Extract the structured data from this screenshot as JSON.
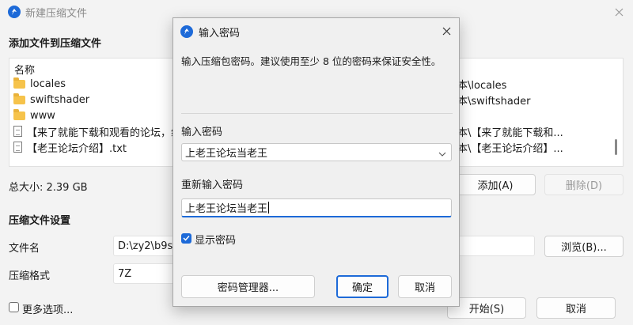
{
  "main_window": {
    "title": "新建压缩文件",
    "add_section_title": "添加文件到压缩文件",
    "column_name": "名称",
    "files": [
      {
        "name": "locales",
        "type": "folder"
      },
      {
        "name": "swiftshader",
        "type": "folder"
      },
      {
        "name": "www",
        "type": "folder"
      },
      {
        "name": "【来了就能下载和观看的论坛，纯",
        "type": "file"
      },
      {
        "name": "【老王论坛介绍】.txt",
        "type": "file"
      }
    ],
    "paths": [
      "本\\locales",
      "本\\swiftshader",
      "",
      "本\\【来了就能下载和...",
      "本\\【老王论坛介绍】..."
    ],
    "total_size": "总大小: 2.39 GB",
    "add_button": "添加(A)",
    "delete_button": "删除(D)",
    "settings_title": "压缩文件设置",
    "filename_label": "文件名",
    "filename_value": "D:\\zy2\\b9sh",
    "browse_button": "浏览(B)...",
    "format_label": "压缩格式",
    "format_value": "7Z",
    "more_options": "更多选项...",
    "start_button": "开始(S)",
    "cancel_button": "取消"
  },
  "dialog": {
    "title": "输入密码",
    "description": "输入压缩包密码。建议使用至少 8 位的密码来保证安全性。",
    "password_label": "输入密码",
    "password_value": "上老王论坛当老王",
    "confirm_label": "重新输入密码",
    "confirm_value": "上老王论坛当老王",
    "show_password_label": "显示密码",
    "show_password_checked": true,
    "manager_button": "密码管理器...",
    "ok_button": "确定",
    "cancel_button": "取消"
  },
  "colors": {
    "accent": "#1d6ad8",
    "window_bg": "#f3f3f3",
    "dialog_bg": "#f0f0f0"
  }
}
